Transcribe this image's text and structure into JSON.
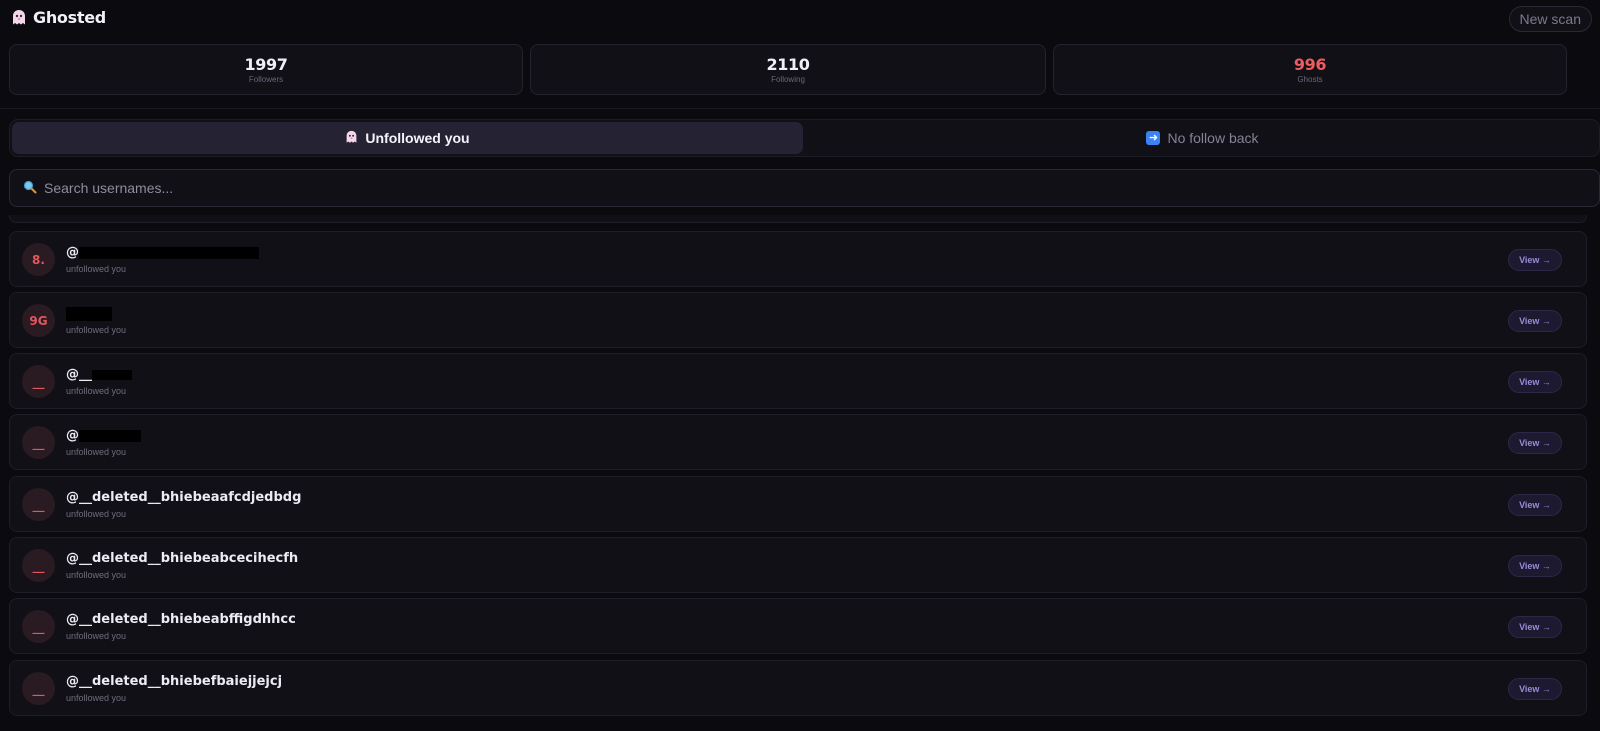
{
  "app": {
    "title": "Ghosted",
    "new_scan_label": "New scan"
  },
  "stats": [
    {
      "value": "1997",
      "label": "Followers"
    },
    {
      "value": "2110",
      "label": "Following"
    },
    {
      "value": "996",
      "label": "Ghosts"
    }
  ],
  "tabs": [
    {
      "label": "Unfollowed you",
      "icon": "ghost-icon",
      "active": true
    },
    {
      "label": "No follow back",
      "icon": "arrow-right-icon",
      "active": false
    }
  ],
  "search": {
    "placeholder": "Search usernames..."
  },
  "rows": [
    {
      "initials": "8.",
      "username": "@",
      "status": "unfollowed you",
      "view_label": "View →",
      "redacted": true
    },
    {
      "initials": "9G",
      "username": "",
      "status": "unfollowed you",
      "view_label": "View →",
      "redacted": true
    },
    {
      "initials": "__",
      "username": "@__",
      "status": "unfollowed you",
      "view_label": "View →",
      "redacted": true
    },
    {
      "initials": "__",
      "username": "@",
      "status": "unfollowed you",
      "view_label": "View →",
      "redacted": true
    },
    {
      "initials": "__",
      "username": "@__deleted__bhiebeaafcdjedbdg",
      "status": "unfollowed you",
      "view_label": "View →",
      "redacted": false
    },
    {
      "initials": "__",
      "username": "@__deleted__bhiebeabcecihecfh",
      "status": "unfollowed you",
      "view_label": "View →",
      "redacted": false
    },
    {
      "initials": "__",
      "username": "@__deleted__bhiebeabffigdhhcc",
      "status": "unfollowed you",
      "view_label": "View →",
      "redacted": false
    },
    {
      "initials": "__",
      "username": "@__deleted__bhiebefbaiejjejcj",
      "status": "unfollowed you",
      "view_label": "View →",
      "redacted": false
    }
  ],
  "colors": {
    "accent_ghost": "#ec5d62",
    "view_text": "#9a8cd6",
    "background": "#0b0a0f"
  }
}
